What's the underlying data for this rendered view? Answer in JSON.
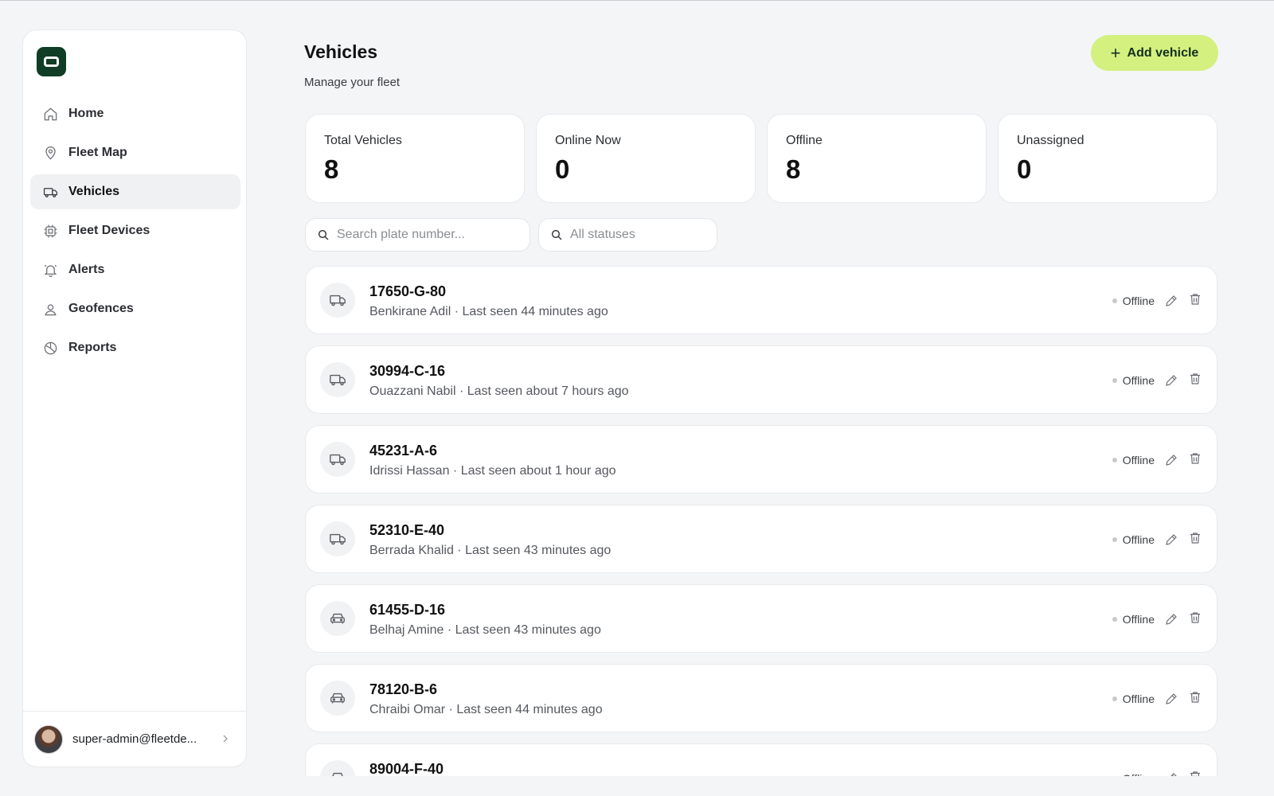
{
  "page": {
    "title": "Vehicles",
    "subtitle": "Manage your fleet",
    "add_button_label": "Add vehicle"
  },
  "sidebar": {
    "items": [
      {
        "label": "Home",
        "icon": "home-icon"
      },
      {
        "label": "Fleet Map",
        "icon": "map-pin-icon"
      },
      {
        "label": "Vehicles",
        "icon": "truck-icon",
        "active": true
      },
      {
        "label": "Fleet Devices",
        "icon": "chip-icon"
      },
      {
        "label": "Alerts",
        "icon": "bell-icon"
      },
      {
        "label": "Geofences",
        "icon": "geofence-icon"
      },
      {
        "label": "Reports",
        "icon": "pie-chart-icon"
      }
    ],
    "user_email": "super-admin@fleetde..."
  },
  "stats": [
    {
      "label": "Total Vehicles",
      "value": "8"
    },
    {
      "label": "Online Now",
      "value": "0"
    },
    {
      "label": "Offline",
      "value": "8"
    },
    {
      "label": "Unassigned",
      "value": "0"
    }
  ],
  "filters": {
    "search_placeholder": "Search plate number...",
    "status_value": "All statuses"
  },
  "vehicles": [
    {
      "plate": "17650-G-80",
      "meta": "Benkirane Adil · Last seen 44 minutes ago",
      "status": "Offline",
      "icon": "truck-icon"
    },
    {
      "plate": "30994-C-16",
      "meta": "Ouazzani Nabil · Last seen about 7 hours ago",
      "status": "Offline",
      "icon": "truck-icon"
    },
    {
      "plate": "45231-A-6",
      "meta": "Idrissi Hassan · Last seen about 1 hour ago",
      "status": "Offline",
      "icon": "truck-icon"
    },
    {
      "plate": "52310-E-40",
      "meta": "Berrada Khalid · Last seen 43 minutes ago",
      "status": "Offline",
      "icon": "truck-icon"
    },
    {
      "plate": "61455-D-16",
      "meta": "Belhaj Amine · Last seen 43 minutes ago",
      "status": "Offline",
      "icon": "car-icon"
    },
    {
      "plate": "78120-B-6",
      "meta": "Chraibi Omar · Last seen 44 minutes ago",
      "status": "Offline",
      "icon": "car-icon"
    },
    {
      "plate": "89004-F-40",
      "meta": "",
      "status": "Offline",
      "icon": "car-icon"
    }
  ],
  "colors": {
    "accent": "#d4f07f",
    "logo": "#0f3d25",
    "background": "#f4f5f7"
  }
}
